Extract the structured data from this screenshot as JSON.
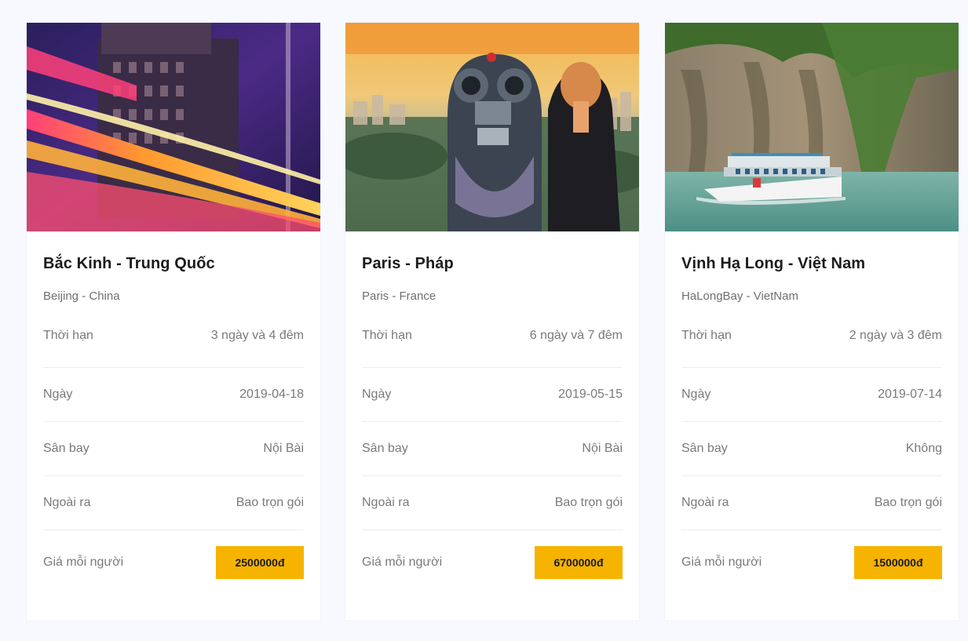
{
  "colors": {
    "page_bg": "#f8f9ff",
    "card_bg": "#ffffff",
    "accent": "#f6b300",
    "text_dark": "#1b1b1b",
    "text_muted": "#7a7a7a"
  },
  "tours": [
    {
      "image": "beijing-night-street-photo",
      "title": "Bắc Kinh - Trung Quốc",
      "subtitle": "Beijing - China",
      "rows": [
        {
          "label": "Thời hạn",
          "value": "3 ngày và 4 đêm"
        },
        {
          "label": "Ngày",
          "value": "2019-04-18"
        },
        {
          "label": "Sân bay",
          "value": "Nội Bài"
        },
        {
          "label": "Ngoài ra",
          "value": "Bao trọn gói"
        }
      ],
      "price_label": "Giá mỗi người",
      "price": "2500000đ"
    },
    {
      "image": "paris-binocular-view-photo",
      "title": "Paris - Pháp",
      "subtitle": "Paris - France",
      "rows": [
        {
          "label": "Thời hạn",
          "value": "6 ngày và 7 đêm"
        },
        {
          "label": "Ngày",
          "value": "2019-05-15"
        },
        {
          "label": "Sân bay",
          "value": "Nội Bài"
        },
        {
          "label": "Ngoài ra",
          "value": "Bao trọn gói"
        }
      ],
      "price_label": "Giá mỗi người",
      "price": "6700000đ"
    },
    {
      "image": "halong-bay-boat-photo",
      "title": "Vịnh Hạ Long - Việt Nam",
      "subtitle": "HaLongBay - VietNam",
      "rows": [
        {
          "label": "Thời hạn",
          "value": "2 ngày và 3 đêm"
        },
        {
          "label": "Ngày",
          "value": "2019-07-14"
        },
        {
          "label": "Sân bay",
          "value": "Không"
        },
        {
          "label": "Ngoài ra",
          "value": "Bao trọn gói"
        }
      ],
      "price_label": "Giá mỗi người",
      "price": "1500000đ"
    }
  ]
}
